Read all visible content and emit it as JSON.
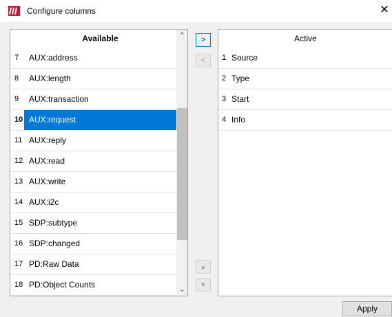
{
  "window": {
    "title": "Configure columns",
    "close_symbol": "✕"
  },
  "available": {
    "header": "Available",
    "rows": [
      {
        "num": "7",
        "label": "AUX:address"
      },
      {
        "num": "8",
        "label": "AUX:length"
      },
      {
        "num": "9",
        "label": "AUX:transaction"
      },
      {
        "num": "10",
        "label": "AUX:request",
        "selected": true
      },
      {
        "num": "11",
        "label": "AUX:reply"
      },
      {
        "num": "12",
        "label": "AUX:read"
      },
      {
        "num": "13",
        "label": "AUX:write"
      },
      {
        "num": "14",
        "label": "AUX:i2c"
      },
      {
        "num": "15",
        "label": "SDP:subtype"
      },
      {
        "num": "16",
        "label": "SDP:changed"
      },
      {
        "num": "17",
        "label": "PD:Raw Data"
      },
      {
        "num": "18",
        "label": "PD:Object Counts"
      }
    ]
  },
  "active": {
    "header": "Active",
    "rows": [
      {
        "num": "1",
        "label": "Source"
      },
      {
        "num": "2",
        "label": "Type"
      },
      {
        "num": "3",
        "label": "Start"
      },
      {
        "num": "4",
        "label": "Info"
      }
    ]
  },
  "buttons": {
    "move_right": ">",
    "move_left": "<",
    "move_up": "▲",
    "move_down": "▼",
    "apply": "Apply"
  },
  "scrollbar": {
    "up_arrow": "^",
    "down_arrow": "⌄"
  },
  "colors": {
    "selection": "#0078d7",
    "brand": "#c8102e"
  }
}
